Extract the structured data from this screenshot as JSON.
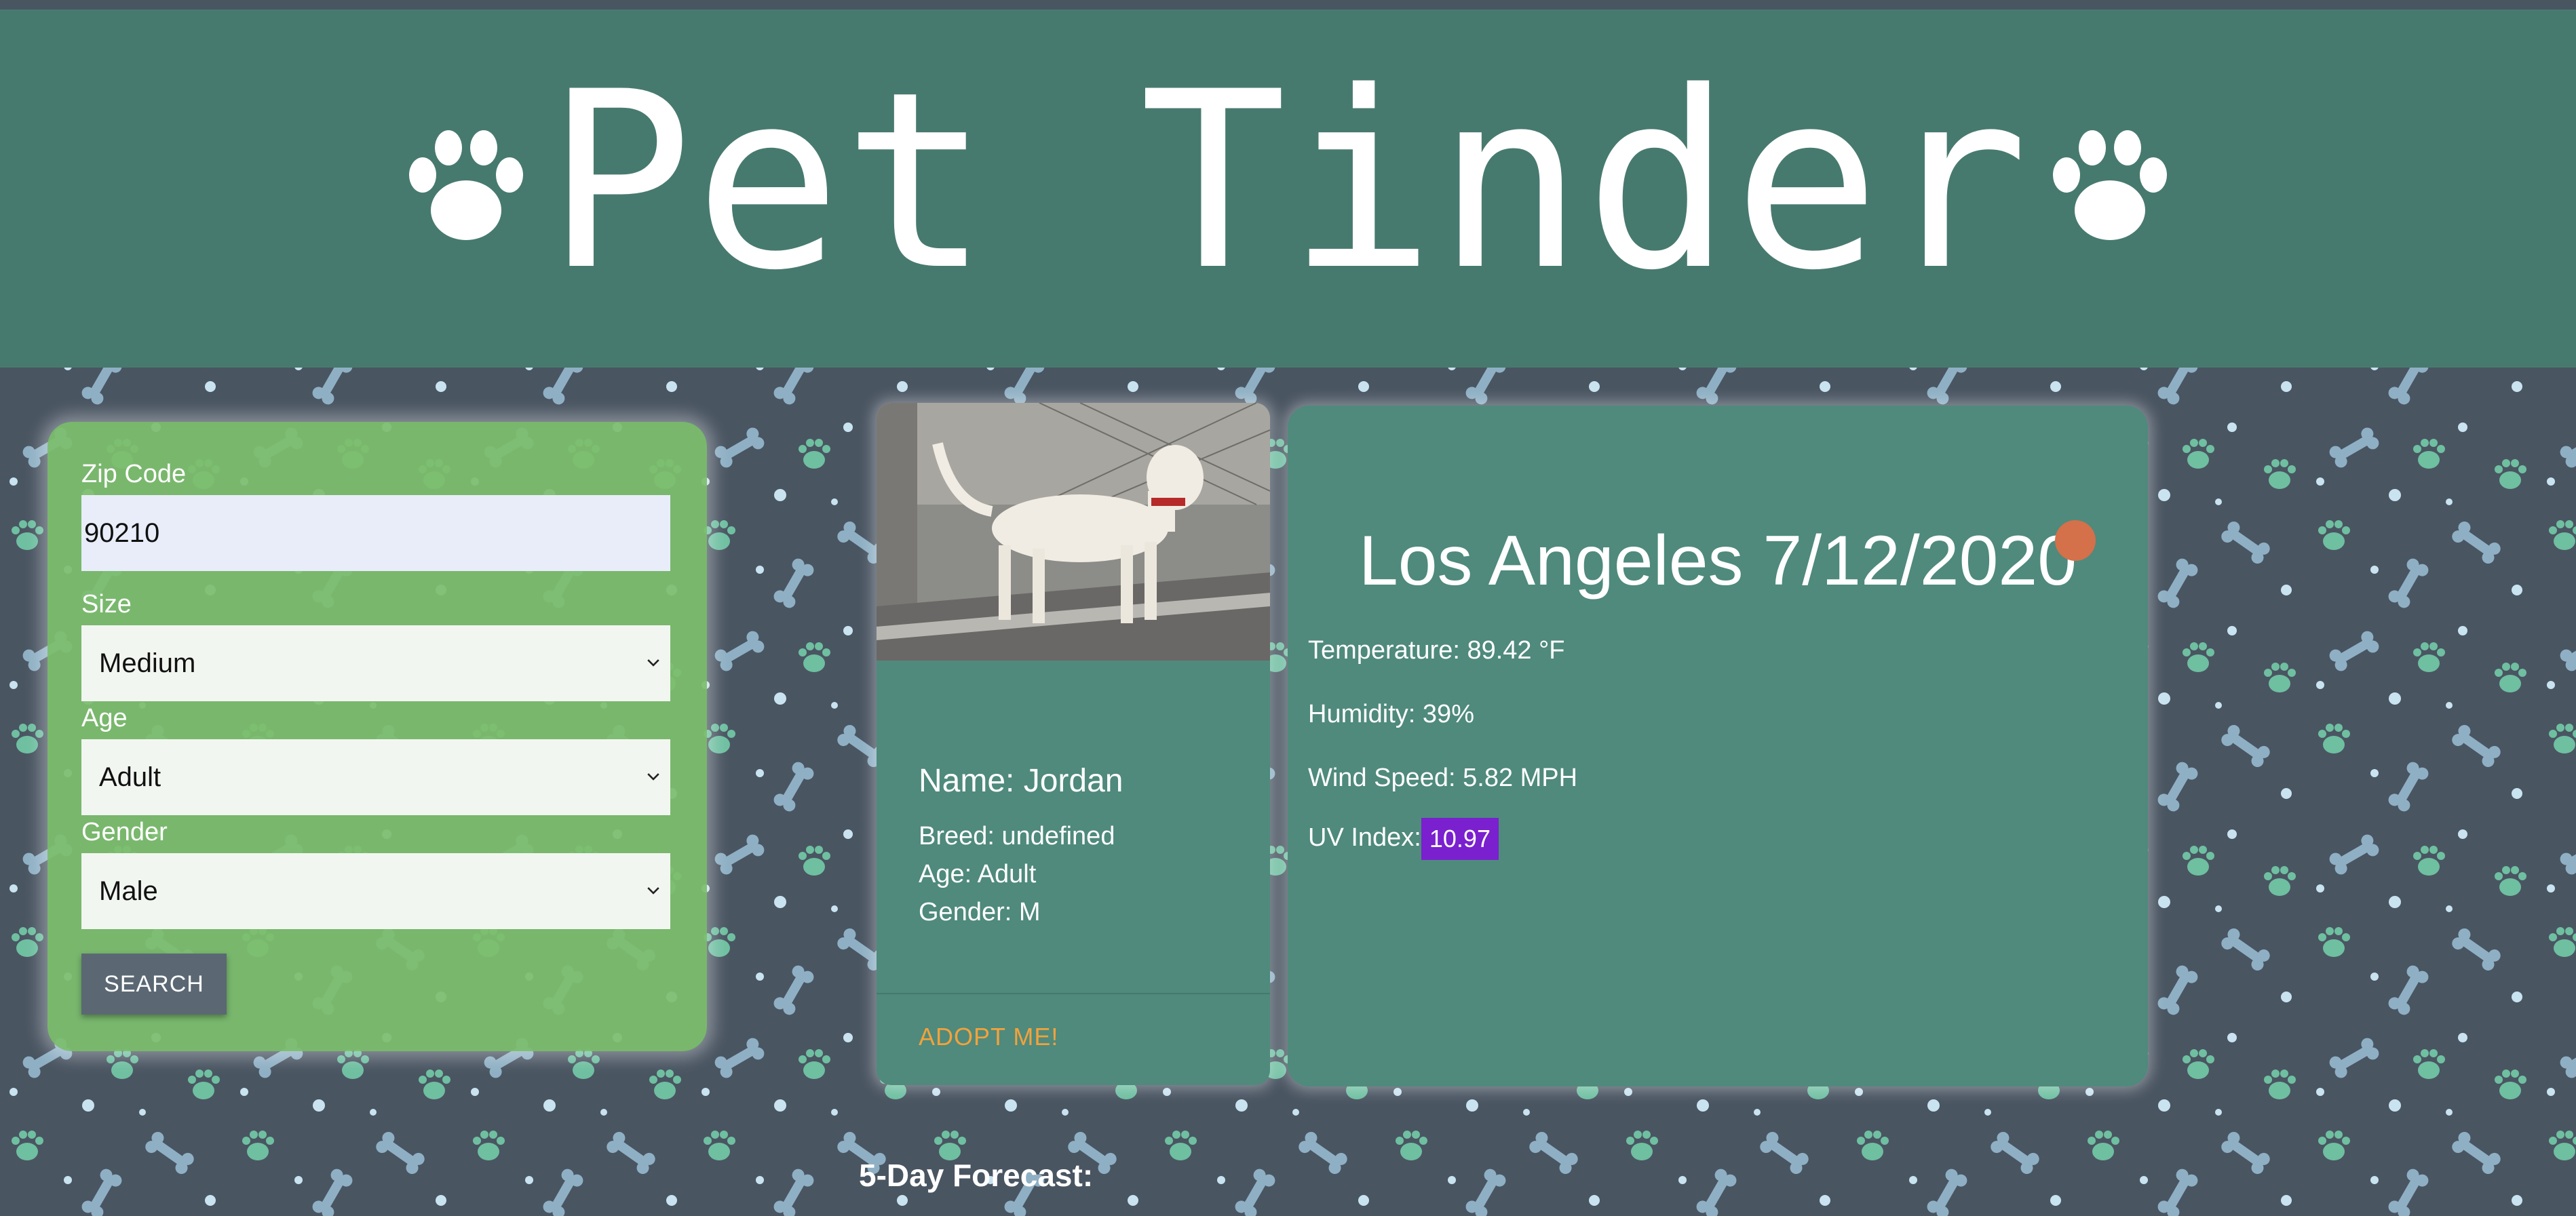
{
  "header": {
    "title": "Pet Tinder"
  },
  "search": {
    "zip_label": "Zip Code",
    "zip_value": "90210",
    "size_label": "Size",
    "size_value": "Medium",
    "age_label": "Age",
    "age_value": "Adult",
    "gender_label": "Gender",
    "gender_value": "Male",
    "button_label": "SEARCH"
  },
  "pet": {
    "name": "Name: Jordan",
    "breed": "Breed: undefined",
    "age": "Age: Adult",
    "gender": "Gender: M",
    "adopt_label": "ADOPT ME!"
  },
  "weather": {
    "city_date": "Los Angeles 7/12/2020",
    "icon": "sun-icon",
    "temperature": "Temperature: 89.42 °F",
    "humidity": "Humidity: 39%",
    "wind": "Wind Speed: 5.82 MPH",
    "uv_label": "UV Index:",
    "uv_value": "10.97"
  },
  "forecast": {
    "title": "5-Day Forecast:"
  },
  "colors": {
    "header_bg": "#477a6e",
    "card_bg": "#4f8a7c",
    "search_panel_bg": "#7dbe6e",
    "uv_badge": "#7a20cf",
    "adopt_link": "#f2a23b",
    "weather_icon": "#d4704a",
    "page_bg": "#4a5562"
  }
}
